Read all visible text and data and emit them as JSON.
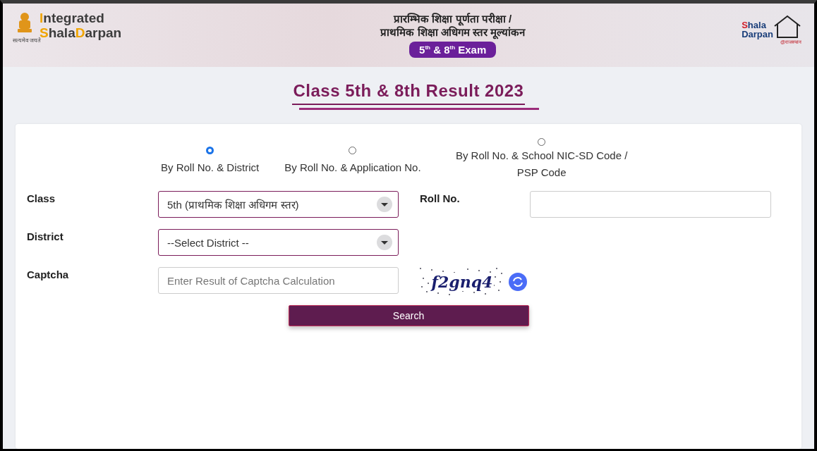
{
  "header": {
    "logo_left": {
      "line1_initial": "I",
      "line1_rest": "ntegrated",
      "line2_initial": "S",
      "line2_mid": "hala",
      "line2_initial2": "D",
      "line2_rest": "arpan",
      "motto": "सत्यमेव जयते"
    },
    "title_lines": [
      "प्रारम्भिक शिक्षा पूर्णता परीक्षा /",
      "प्राथमिक शिक्षा अधिगम स्तर मूल्यांकन"
    ],
    "badge": "5$^{th}$ & 8$^{th}$ Exam",
    "logo_right": {
      "line1_initial": "S",
      "line1_rest": "hala",
      "line2": "Darpan",
      "tagline": "@राजस्थान"
    }
  },
  "page_title": "Class 5th & 8th Result 2023",
  "search_options": [
    {
      "label": "By Roll No. & District",
      "selected": true
    },
    {
      "label": "By Roll No. & Application No.",
      "selected": false
    },
    {
      "label": "By Roll No. & School NIC-SD Code / PSP Code",
      "selected": false
    }
  ],
  "form": {
    "class": {
      "label": "Class",
      "value": "5th (प्राथमिक शिक्षा अधिगम स्तर)"
    },
    "roll_no": {
      "label": "Roll No."
    },
    "district": {
      "label": "District",
      "value": "--Select District --"
    },
    "captcha": {
      "label": "Captcha",
      "placeholder": "Enter Result of Captcha Calculation",
      "code": "f2gnq4"
    }
  },
  "search_button": "Search"
}
